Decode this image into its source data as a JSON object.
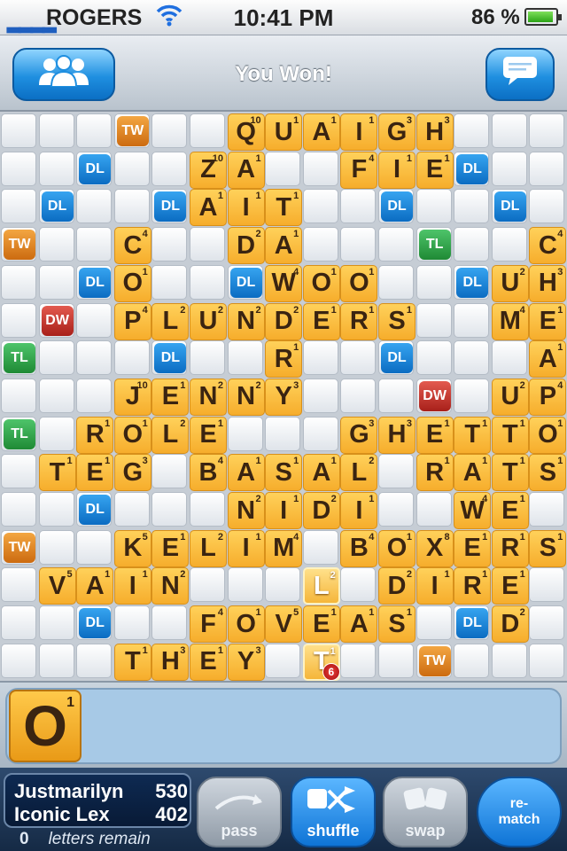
{
  "status_bar": {
    "signal": "▂▂▂▂",
    "carrier": "ROGERS",
    "wifi_icon": "wifi-icon",
    "time": "10:41 PM",
    "battery": "86 %"
  },
  "nav": {
    "title": "You Won!",
    "left_icon": "players-icon",
    "right_icon": "chat-bubble-icon"
  },
  "board": {
    "premium": [
      {
        "r": 0,
        "c": 3,
        "t": "TW"
      },
      {
        "r": 1,
        "c": 2,
        "t": "DL"
      },
      {
        "r": 1,
        "c": 12,
        "t": "DL"
      },
      {
        "r": 2,
        "c": 1,
        "t": "DL"
      },
      {
        "r": 2,
        "c": 4,
        "t": "DL"
      },
      {
        "r": 2,
        "c": 10,
        "t": "DL"
      },
      {
        "r": 2,
        "c": 13,
        "t": "DL"
      },
      {
        "r": 3,
        "c": 0,
        "t": "TW"
      },
      {
        "r": 3,
        "c": 11,
        "t": "TL"
      },
      {
        "r": 4,
        "c": 2,
        "t": "DL"
      },
      {
        "r": 4,
        "c": 6,
        "t": "DL"
      },
      {
        "r": 4,
        "c": 12,
        "t": "DL"
      },
      {
        "r": 5,
        "c": 1,
        "t": "DW"
      },
      {
        "r": 6,
        "c": 0,
        "t": "TL"
      },
      {
        "r": 6,
        "c": 4,
        "t": "DL"
      },
      {
        "r": 6,
        "c": 10,
        "t": "DL"
      },
      {
        "r": 7,
        "c": 11,
        "t": "DW"
      },
      {
        "r": 8,
        "c": 0,
        "t": "TL"
      },
      {
        "r": 10,
        "c": 2,
        "t": "DL"
      },
      {
        "r": 11,
        "c": 0,
        "t": "TW"
      },
      {
        "r": 13,
        "c": 2,
        "t": "DL"
      },
      {
        "r": 13,
        "c": 12,
        "t": "DL"
      },
      {
        "r": 14,
        "c": 11,
        "t": "TW"
      }
    ],
    "tiles": [
      {
        "r": 0,
        "c": 6,
        "l": "Q",
        "p": "10"
      },
      {
        "r": 0,
        "c": 7,
        "l": "U",
        "p": "1"
      },
      {
        "r": 0,
        "c": 8,
        "l": "A",
        "p": "1"
      },
      {
        "r": 0,
        "c": 9,
        "l": "I",
        "p": "1"
      },
      {
        "r": 0,
        "c": 10,
        "l": "G",
        "p": "3"
      },
      {
        "r": 0,
        "c": 11,
        "l": "H",
        "p": "3"
      },
      {
        "r": 1,
        "c": 5,
        "l": "Z",
        "p": "10"
      },
      {
        "r": 1,
        "c": 6,
        "l": "A",
        "p": "1"
      },
      {
        "r": 1,
        "c": 9,
        "l": "F",
        "p": "4"
      },
      {
        "r": 1,
        "c": 10,
        "l": "I",
        "p": "1"
      },
      {
        "r": 1,
        "c": 11,
        "l": "E",
        "p": "1"
      },
      {
        "r": 2,
        "c": 5,
        "l": "A",
        "p": "1"
      },
      {
        "r": 2,
        "c": 6,
        "l": "I",
        "p": "1"
      },
      {
        "r": 2,
        "c": 7,
        "l": "T",
        "p": "1"
      },
      {
        "r": 3,
        "c": 3,
        "l": "C",
        "p": "4"
      },
      {
        "r": 3,
        "c": 6,
        "l": "D",
        "p": "2"
      },
      {
        "r": 3,
        "c": 7,
        "l": "A",
        "p": "1"
      },
      {
        "r": 3,
        "c": 14,
        "l": "C",
        "p": "4"
      },
      {
        "r": 4,
        "c": 3,
        "l": "O",
        "p": "1"
      },
      {
        "r": 4,
        "c": 7,
        "l": "W",
        "p": "4"
      },
      {
        "r": 4,
        "c": 8,
        "l": "O",
        "p": "1"
      },
      {
        "r": 4,
        "c": 9,
        "l": "O",
        "p": "1"
      },
      {
        "r": 4,
        "c": 13,
        "l": "U",
        "p": "2"
      },
      {
        "r": 4,
        "c": 14,
        "l": "H",
        "p": "3"
      },
      {
        "r": 5,
        "c": 3,
        "l": "P",
        "p": "4"
      },
      {
        "r": 5,
        "c": 4,
        "l": "L",
        "p": "2"
      },
      {
        "r": 5,
        "c": 5,
        "l": "U",
        "p": "2"
      },
      {
        "r": 5,
        "c": 6,
        "l": "N",
        "p": "2"
      },
      {
        "r": 5,
        "c": 7,
        "l": "D",
        "p": "2"
      },
      {
        "r": 5,
        "c": 8,
        "l": "E",
        "p": "1"
      },
      {
        "r": 5,
        "c": 9,
        "l": "R",
        "p": "1"
      },
      {
        "r": 5,
        "c": 10,
        "l": "S",
        "p": "1"
      },
      {
        "r": 5,
        "c": 13,
        "l": "M",
        "p": "4"
      },
      {
        "r": 5,
        "c": 14,
        "l": "E",
        "p": "1"
      },
      {
        "r": 6,
        "c": 7,
        "l": "R",
        "p": "1"
      },
      {
        "r": 6,
        "c": 14,
        "l": "A",
        "p": "1"
      },
      {
        "r": 7,
        "c": 3,
        "l": "J",
        "p": "10"
      },
      {
        "r": 7,
        "c": 4,
        "l": "E",
        "p": "1"
      },
      {
        "r": 7,
        "c": 5,
        "l": "N",
        "p": "2"
      },
      {
        "r": 7,
        "c": 6,
        "l": "N",
        "p": "2"
      },
      {
        "r": 7,
        "c": 7,
        "l": "Y",
        "p": "3"
      },
      {
        "r": 7,
        "c": 13,
        "l": "U",
        "p": "2"
      },
      {
        "r": 7,
        "c": 14,
        "l": "P",
        "p": "4"
      },
      {
        "r": 8,
        "c": 2,
        "l": "R",
        "p": "1"
      },
      {
        "r": 8,
        "c": 3,
        "l": "O",
        "p": "1"
      },
      {
        "r": 8,
        "c": 4,
        "l": "L",
        "p": "2"
      },
      {
        "r": 8,
        "c": 5,
        "l": "E",
        "p": "1"
      },
      {
        "r": 8,
        "c": 9,
        "l": "G",
        "p": "3"
      },
      {
        "r": 8,
        "c": 10,
        "l": "H",
        "p": "3"
      },
      {
        "r": 8,
        "c": 11,
        "l": "E",
        "p": "1"
      },
      {
        "r": 8,
        "c": 12,
        "l": "T",
        "p": "1"
      },
      {
        "r": 8,
        "c": 13,
        "l": "T",
        "p": "1"
      },
      {
        "r": 8,
        "c": 14,
        "l": "O",
        "p": "1"
      },
      {
        "r": 9,
        "c": 1,
        "l": "T",
        "p": "1"
      },
      {
        "r": 9,
        "c": 2,
        "l": "E",
        "p": "1"
      },
      {
        "r": 9,
        "c": 3,
        "l": "G",
        "p": "3"
      },
      {
        "r": 9,
        "c": 5,
        "l": "B",
        "p": "4"
      },
      {
        "r": 9,
        "c": 6,
        "l": "A",
        "p": "1"
      },
      {
        "r": 9,
        "c": 7,
        "l": "S",
        "p": "1"
      },
      {
        "r": 9,
        "c": 8,
        "l": "A",
        "p": "1"
      },
      {
        "r": 9,
        "c": 9,
        "l": "L",
        "p": "2"
      },
      {
        "r": 9,
        "c": 11,
        "l": "R",
        "p": "1"
      },
      {
        "r": 9,
        "c": 12,
        "l": "A",
        "p": "1"
      },
      {
        "r": 9,
        "c": 13,
        "l": "T",
        "p": "1"
      },
      {
        "r": 9,
        "c": 14,
        "l": "S",
        "p": "1"
      },
      {
        "r": 10,
        "c": 6,
        "l": "N",
        "p": "2"
      },
      {
        "r": 10,
        "c": 7,
        "l": "I",
        "p": "1"
      },
      {
        "r": 10,
        "c": 8,
        "l": "D",
        "p": "2"
      },
      {
        "r": 10,
        "c": 9,
        "l": "I",
        "p": "1"
      },
      {
        "r": 10,
        "c": 12,
        "l": "W",
        "p": "4"
      },
      {
        "r": 10,
        "c": 13,
        "l": "E",
        "p": "1"
      },
      {
        "r": 11,
        "c": 3,
        "l": "K",
        "p": "5"
      },
      {
        "r": 11,
        "c": 4,
        "l": "E",
        "p": "1"
      },
      {
        "r": 11,
        "c": 5,
        "l": "L",
        "p": "2"
      },
      {
        "r": 11,
        "c": 6,
        "l": "I",
        "p": "1"
      },
      {
        "r": 11,
        "c": 7,
        "l": "M",
        "p": "4"
      },
      {
        "r": 11,
        "c": 9,
        "l": "B",
        "p": "4"
      },
      {
        "r": 11,
        "c": 10,
        "l": "O",
        "p": "1"
      },
      {
        "r": 11,
        "c": 11,
        "l": "X",
        "p": "8"
      },
      {
        "r": 11,
        "c": 12,
        "l": "E",
        "p": "1"
      },
      {
        "r": 11,
        "c": 13,
        "l": "R",
        "p": "1"
      },
      {
        "r": 11,
        "c": 14,
        "l": "S",
        "p": "1"
      },
      {
        "r": 12,
        "c": 1,
        "l": "V",
        "p": "5"
      },
      {
        "r": 12,
        "c": 2,
        "l": "A",
        "p": "1"
      },
      {
        "r": 12,
        "c": 3,
        "l": "I",
        "p": "1"
      },
      {
        "r": 12,
        "c": 4,
        "l": "N",
        "p": "2"
      },
      {
        "r": 12,
        "c": 8,
        "l": "L",
        "p": "2",
        "last": true
      },
      {
        "r": 12,
        "c": 10,
        "l": "D",
        "p": "2"
      },
      {
        "r": 12,
        "c": 11,
        "l": "I",
        "p": "1"
      },
      {
        "r": 12,
        "c": 12,
        "l": "R",
        "p": "1"
      },
      {
        "r": 12,
        "c": 13,
        "l": "E",
        "p": "1"
      },
      {
        "r": 13,
        "c": 5,
        "l": "F",
        "p": "4"
      },
      {
        "r": 13,
        "c": 6,
        "l": "O",
        "p": "1"
      },
      {
        "r": 13,
        "c": 7,
        "l": "V",
        "p": "5"
      },
      {
        "r": 13,
        "c": 8,
        "l": "E",
        "p": "1"
      },
      {
        "r": 13,
        "c": 9,
        "l": "A",
        "p": "1"
      },
      {
        "r": 13,
        "c": 10,
        "l": "S",
        "p": "1"
      },
      {
        "r": 13,
        "c": 13,
        "l": "D",
        "p": "2"
      },
      {
        "r": 14,
        "c": 3,
        "l": "T",
        "p": "1"
      },
      {
        "r": 14,
        "c": 4,
        "l": "H",
        "p": "3"
      },
      {
        "r": 14,
        "c": 5,
        "l": "E",
        "p": "1"
      },
      {
        "r": 14,
        "c": 6,
        "l": "Y",
        "p": "3"
      },
      {
        "r": 14,
        "c": 8,
        "l": "T",
        "p": "1",
        "last": true
      }
    ],
    "last_move_score": "6"
  },
  "rack": {
    "tiles": [
      {
        "letter": "O",
        "points": "1"
      }
    ]
  },
  "scores": {
    "players": [
      {
        "name": "Justmarilyn",
        "score": "530"
      },
      {
        "name": "Iconic Lex",
        "score": "402"
      }
    ],
    "letters_remaining": "0",
    "remain_label": "letters remain"
  },
  "actions": {
    "pass": "pass",
    "shuffle": "shuffle",
    "swap": "swap",
    "rematch": "re-\nmatch"
  }
}
